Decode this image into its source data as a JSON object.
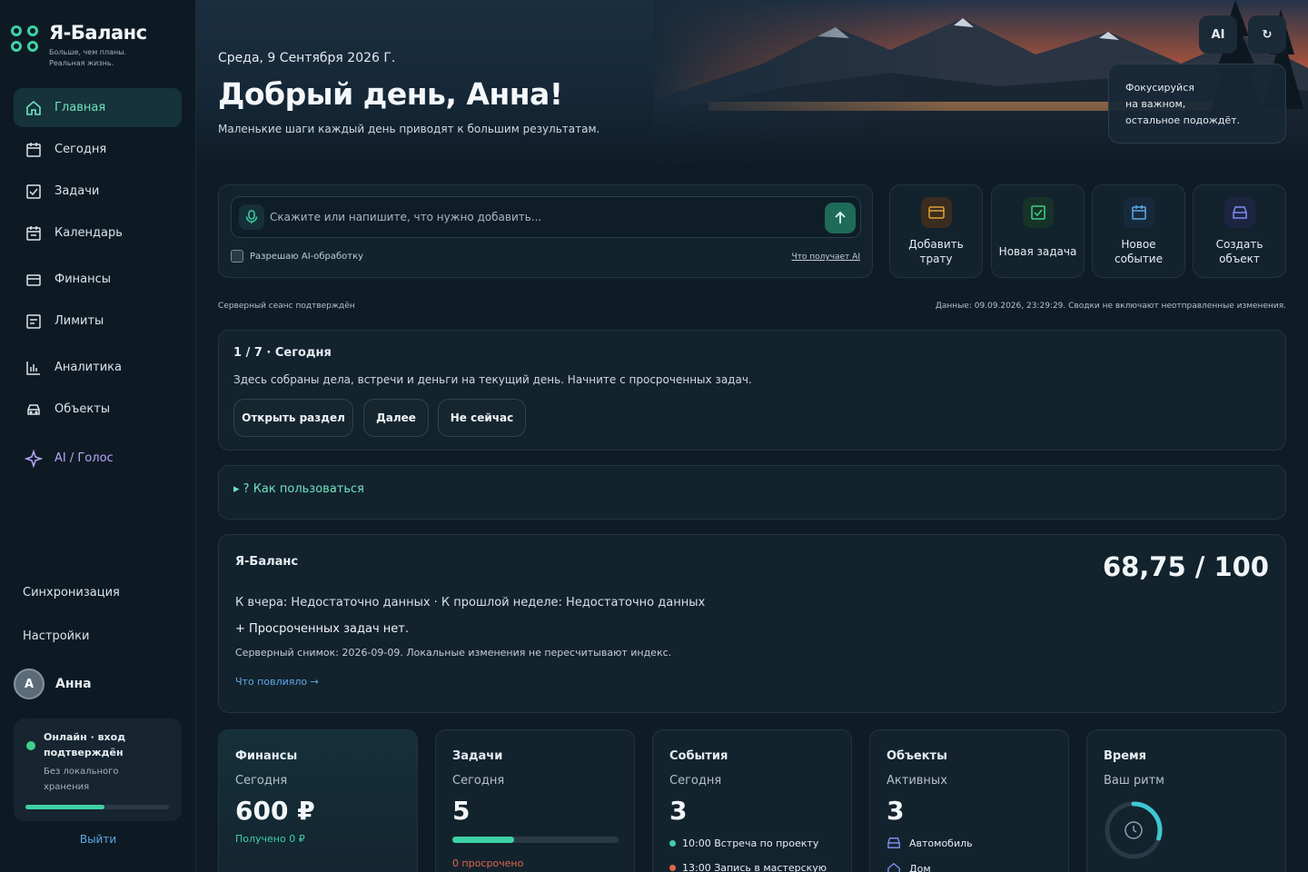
{
  "app": {
    "name": "Я-Баланс",
    "tagline": "Больше, чем планы. Реальная жизнь."
  },
  "sidebar": {
    "items": [
      {
        "label": "Главная",
        "icon": "home-icon",
        "active": true
      },
      {
        "label": "Сегодня",
        "icon": "calendar-today-icon"
      },
      {
        "label": "Задачи",
        "icon": "checkbox-icon"
      },
      {
        "label": "Календарь",
        "icon": "calendar-icon"
      },
      {
        "label": "Финансы",
        "icon": "wallet-icon"
      },
      {
        "label": "Лимиты",
        "icon": "limits-icon"
      },
      {
        "label": "Аналитика",
        "icon": "bar-chart-icon"
      },
      {
        "label": "Объекты",
        "icon": "car-icon"
      },
      {
        "label": "AI / Голос",
        "icon": "sparkle-icon"
      }
    ],
    "sync_label": "Синхронизация",
    "settings_label": "Настройки",
    "user": {
      "initial": "А",
      "name": "Анна"
    },
    "status": {
      "title": "Онлайн · вход подтверждён",
      "subtitle": "Без локального хранения",
      "progress": 0.55
    },
    "logout_label": "Выйти"
  },
  "header": {
    "date": "Среда, 9 Сентября 2026 Г.",
    "greeting": "Добрый день, Анна!",
    "subtitle": "Маленькие шаги каждый день приводят к большим результатам.",
    "ai_button": "AI",
    "refresh_icon": "refresh-icon",
    "focus_text": [
      "Фокусируйся",
      "на важном,",
      "остальное подождёт."
    ]
  },
  "quick_input": {
    "placeholder": "Скажите или напишите, что нужно добавить...",
    "value": "",
    "consent_label": "Разрешаю AI-обработку",
    "consent_checked": false,
    "ai_link": "Что получает AI"
  },
  "actions": [
    {
      "label": "Добавить трату",
      "icon": "wallet-icon",
      "color": "#e0a23a",
      "bg": "#3a2c1f"
    },
    {
      "label": "Новая задача",
      "icon": "checkbox-icon",
      "color": "#3ed18a",
      "bg": "#173329"
    },
    {
      "label": "Новое событие",
      "icon": "calendar-icon",
      "color": "#5fa9e6",
      "bg": "#172a3b"
    },
    {
      "label": "Создать объект",
      "icon": "car-icon",
      "color": "#7e8cf0",
      "bg": "#1c2540"
    }
  ],
  "meta": {
    "session": "Серверный сеанс подтверждён",
    "data_stamp": "Данные: 09.09.2026, 23:29:29. Сводки не включают неотправленные изменения."
  },
  "onboarding": {
    "title": "1 / 7 · Сегодня",
    "text": "Здесь собраны дела, встречи и деньги на текущий день. Начните с просроченных задач.",
    "buttons": [
      "Открыть раздел",
      "Далее",
      "Не сейчас"
    ]
  },
  "howto": {
    "label": "▸ ? Как пользоваться"
  },
  "balance": {
    "title": "Я-Баланс",
    "score": "68,75 / 100",
    "compare": "К вчера: Недостаточно данных · К прошлой неделе: Недостаточно данных",
    "highlight": "+ Просроченных задач нет.",
    "snapshot": "Серверный снимок: 2026-09-09. Локальные изменения не пересчитывают индекс.",
    "link": "Что повлияло →"
  },
  "stats": {
    "finance": {
      "title": "Финансы",
      "sub": "Сегодня",
      "value": "600 ₽",
      "note": "Получено 0 ₽"
    },
    "tasks": {
      "title": "Задачи",
      "sub": "Сегодня",
      "value": "5",
      "progress": 0.37,
      "note": "0 просрочено"
    },
    "events": {
      "title": "События",
      "sub": "Сегодня",
      "value": "3",
      "items": [
        "10:00 Встреча по проекту",
        "13:00 Запись в мастерскую"
      ]
    },
    "objects": {
      "title": "Объекты",
      "sub": "Активных",
      "value": "3",
      "items": [
        "Автомобиль",
        "Дом"
      ]
    },
    "time": {
      "title": "Время",
      "sub": "Ваш ритм",
      "ring_progress": 0.3
    }
  },
  "colors": {
    "accent": "#3ed1a4",
    "link": "#5fa9e6",
    "ai": "#b9a6ff",
    "warning": "#e0a23a",
    "danger": "#e0664a"
  }
}
